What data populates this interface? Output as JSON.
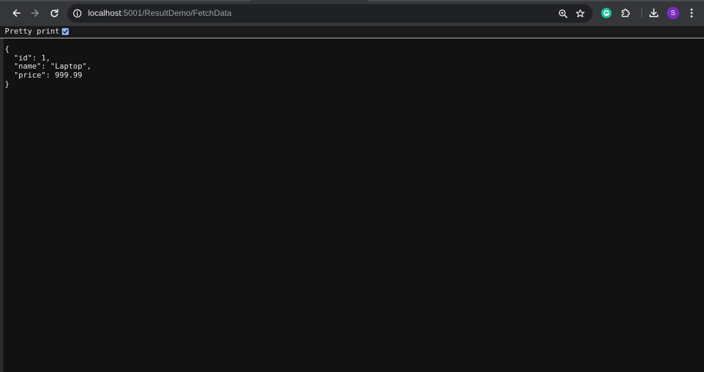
{
  "browser": {
    "url_host": "localhost",
    "url_rest": ":5001/ResultDemo/FetchData",
    "profile_initial": "S",
    "icons": {
      "back": "arrow-left-icon",
      "forward": "arrow-right-icon",
      "reload": "reload-icon",
      "site_info": "info-circle-icon",
      "zoom": "zoom-in-icon",
      "bookmark": "star-icon",
      "grammarly": "grammarly-icon",
      "extensions": "puzzle-icon",
      "downloads": "download-icon",
      "menu": "kebab-menu-icon"
    },
    "colors": {
      "toolbar_bg": "#35363a",
      "omnibox_bg": "#202124",
      "avatar_bg": "#7b2cbf",
      "grammarly": "#15c39a"
    }
  },
  "viewer": {
    "pretty_print_label": "Pretty print",
    "pretty_print_checked": true,
    "json_lines": [
      "{",
      "  \"id\": 1,",
      "  \"name\": \"Laptop\",",
      "  \"price\": 999.99",
      "}"
    ],
    "colors": {
      "page_bg": "#121212",
      "text": "#e8e8e8",
      "checkbox": "#8ab4f8"
    }
  }
}
